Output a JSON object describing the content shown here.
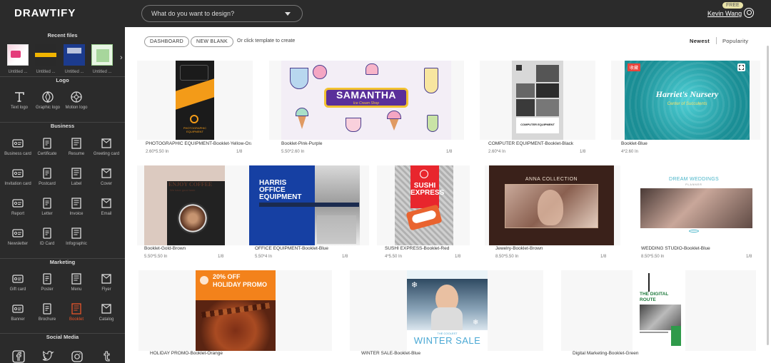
{
  "header": {
    "logo": "DRAWTIFY",
    "search_placeholder": "What do you want to design?",
    "free_badge": "FREE",
    "username": "Kevin Wang"
  },
  "sidebar": {
    "recent_title": "Recent files",
    "recent": [
      {
        "label": "Untitled ..."
      },
      {
        "label": "Untitled ..."
      },
      {
        "label": "Untitled ..."
      },
      {
        "label": "Untitled ..."
      }
    ],
    "logo_title": "Logo",
    "logo_tools": [
      {
        "label": "Text logo",
        "icon": "text-logo-icon"
      },
      {
        "label": "Graphic logo",
        "icon": "graphic-logo-icon"
      },
      {
        "label": "Motion logo",
        "icon": "motion-logo-icon"
      }
    ],
    "business_title": "Business",
    "business_tools": [
      {
        "label": "Business card"
      },
      {
        "label": "Certificate"
      },
      {
        "label": "Resume"
      },
      {
        "label": "Greeting card"
      },
      {
        "label": "Invitation card"
      },
      {
        "label": "Postcard"
      },
      {
        "label": "Label"
      },
      {
        "label": "Cover"
      },
      {
        "label": "Report"
      },
      {
        "label": "Letter"
      },
      {
        "label": "Invoice"
      },
      {
        "label": "Email"
      },
      {
        "label": "Newsletter"
      },
      {
        "label": "ID Card"
      },
      {
        "label": "Infographic"
      }
    ],
    "marketing_title": "Marketing",
    "marketing_tools": [
      {
        "label": "Gift card"
      },
      {
        "label": "Poster"
      },
      {
        "label": "Menu"
      },
      {
        "label": "Flyer"
      },
      {
        "label": "Banner"
      },
      {
        "label": "Brochure"
      },
      {
        "label": "Booklet"
      },
      {
        "label": "Catalog"
      }
    ],
    "social_title": "Social Media",
    "accent": "#e8552b"
  },
  "toolbar": {
    "dashboard": "DASHBOARD",
    "new_blank": "NEW BLANK",
    "hint": "Or click template to create",
    "sort_newest": "Newest",
    "sort_popularity": "Popularity"
  },
  "templates": [
    {
      "name": "PHOTOGRAPHIC EQUIPMENT-Booklet-Yellow-Orar",
      "size": "2.60*5.50 In",
      "pages": "1/8",
      "art": {
        "line1": "PHOTOGRAPHIC",
        "line2": "EQUIPMENT"
      }
    },
    {
      "name": "Booklet-Pink-Purple",
      "size": "5.50*2.60 In",
      "pages": "1/8",
      "art": {
        "title": "SAMANTHA",
        "subtitle": "Ice Cream Shop"
      }
    },
    {
      "name": "COMPUTER EQUIPMENT-Booklet-Black",
      "size": "2.60*4 In",
      "pages": "1/8",
      "art": {
        "title": "COMPUTER EQUIPMENT"
      }
    },
    {
      "name": "Booklet-Blue",
      "size": "4*2.60 In",
      "pages": "",
      "art": {
        "title": "Harriet's Nursery",
        "subtitle": "Center of Succulents",
        "badge": "收藏"
      }
    },
    {
      "name": "Booklet-Gold-Brown",
      "size": "5.50*5.50 In",
      "pages": "1/8",
      "art": {
        "title": "ENJOY COFFEE",
        "subtitle": "We have good taste"
      }
    },
    {
      "name": "OFFICE EQUIPMENT-Booklet-Blue",
      "size": "5.50*4 In",
      "pages": "1/8",
      "art": {
        "line1": "HARRIS",
        "line2": "OFFICE",
        "line3": "EQUIPMENT"
      }
    },
    {
      "name": "SUSHI EXPRESS-Booklet-Red",
      "size": "4*5.50 In",
      "pages": "1/8",
      "art": {
        "line1": "SUSHI",
        "line2": "EXPRESS"
      }
    },
    {
      "name": "Jewelry-Booklet-Brown",
      "size": "8.50*5.50 In",
      "pages": "1/8",
      "art": {
        "title": "ANNA COLLECTION"
      }
    },
    {
      "name": "WEDDING STUDIO-Booklet-Blue",
      "size": "8.50*5.50 In",
      "pages": "1/8",
      "art": {
        "title": "DREAM WEDDINGS",
        "subtitle": "PLANNER"
      }
    },
    {
      "name": "HOLIDAY PROMO-Booklet-Orange",
      "size": "",
      "pages": "",
      "art": {
        "line1": "20% OFF",
        "line2": "HOLIDAY PROMO"
      }
    },
    {
      "name": "WINTER SALE-Booklet-Blue",
      "size": "",
      "pages": "",
      "art": {
        "line1": "THE COOLEST",
        "line2": "WINTER SALE"
      }
    },
    {
      "name": "Digital Marketing-Booklet-Green",
      "size": "",
      "pages": "",
      "art": {
        "line1": "THE DIGITAL",
        "line2": "ROUTE"
      }
    }
  ]
}
